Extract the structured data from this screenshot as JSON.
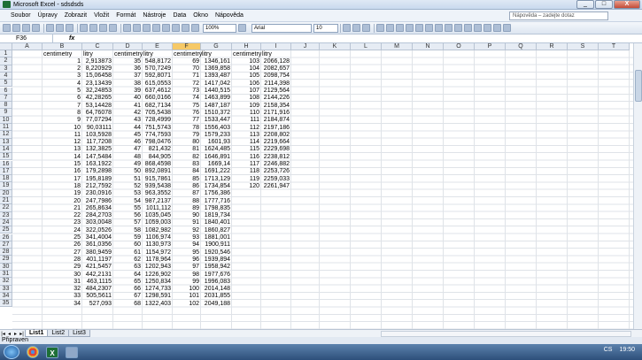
{
  "window": {
    "title": "Microsoft Excel - sdsdsds",
    "minimize": "_",
    "restore": "□",
    "close": "X"
  },
  "menu": [
    "Soubor",
    "Úpravy",
    "Zobrazit",
    "Vložit",
    "Formát",
    "Nástroje",
    "Data",
    "Okno",
    "Nápověda"
  ],
  "help_box": {
    "placeholder": "Nápověda – zadejte dotaz"
  },
  "toolbar": {
    "zoom": "100%",
    "font": "Arial",
    "font_size": "10"
  },
  "formula_bar": {
    "name_box": "F36",
    "fx": "fx",
    "value": ""
  },
  "columns": [
    "A",
    "B",
    "C",
    "D",
    "E",
    "F",
    "G",
    "H",
    "I",
    "J",
    "K",
    "L",
    "M",
    "N",
    "O",
    "P",
    "Q",
    "R",
    "S",
    "T"
  ],
  "selected_column": "F",
  "rows": [
    "1",
    "2",
    "3",
    "4",
    "5",
    "6",
    "7",
    "8",
    "9",
    "10",
    "11",
    "12",
    "13",
    "14",
    "15",
    "16",
    "17",
    "18",
    "19",
    "20",
    "21",
    "22",
    "23",
    "24",
    "25",
    "26",
    "27",
    "28",
    "29",
    "30",
    "31",
    "32",
    "33",
    "34",
    "35"
  ],
  "sheet": {
    "B": [
      "centimetry",
      "1",
      "2",
      "3",
      "4",
      "5",
      "6",
      "7",
      "8",
      "9",
      "10",
      "11",
      "12",
      "13",
      "14",
      "15",
      "16",
      "17",
      "18",
      "19",
      "20",
      "21",
      "22",
      "23",
      "24",
      "25",
      "26",
      "27",
      "28",
      "29",
      "30",
      "31",
      "32",
      "33",
      "34"
    ],
    "C": [
      "litry",
      "2,913873",
      "8,220929",
      "15,06458",
      "23,13439",
      "32,24853",
      "42,28265",
      "53,14428",
      "64,76078",
      "77,07294",
      "90,03111",
      "103,5928",
      "117,7208",
      "132,3825",
      "147,5484",
      "163,1922",
      "179,2898",
      "195,8189",
      "212,7592",
      "230,0916",
      "247,7986",
      "265,8634",
      "284,2703",
      "303,0048",
      "322,0526",
      "341,4004",
      "361,0356",
      "380,9459",
      "401,1197",
      "421,5457",
      "442,2131",
      "463,1115",
      "484,2307",
      "505,5611",
      "527,093"
    ],
    "D": [
      "centimetry",
      "35",
      "36",
      "37",
      "38",
      "39",
      "40",
      "41",
      "42",
      "43",
      "44",
      "45",
      "46",
      "47",
      "48",
      "49",
      "50",
      "51",
      "52",
      "53",
      "54",
      "55",
      "56",
      "57",
      "58",
      "59",
      "60",
      "61",
      "62",
      "63",
      "64",
      "65",
      "66",
      "67",
      "68"
    ],
    "E": [
      "litry",
      "548,8172",
      "570,7249",
      "592,8071",
      "615,0553",
      "637,4612",
      "660,0166",
      "682,7134",
      "705,5438",
      "728,4999",
      "751,5743",
      "774,7593",
      "798,0476",
      "821,432",
      "844,905",
      "868,4598",
      "892,0891",
      "915,7861",
      "939,5438",
      "963,3552",
      "987,2137",
      "1011,112",
      "1035,045",
      "1059,003",
      "1082,982",
      "1106,974",
      "1130,973",
      "1154,972",
      "1178,964",
      "1202,943",
      "1226,902",
      "1250,834",
      "1274,733",
      "1298,591",
      "1322,403"
    ],
    "F": [
      "centimetry",
      "69",
      "70",
      "71",
      "72",
      "73",
      "74",
      "75",
      "76",
      "77",
      "78",
      "79",
      "80",
      "81",
      "82",
      "83",
      "84",
      "85",
      "86",
      "87",
      "88",
      "89",
      "90",
      "91",
      "92",
      "93",
      "94",
      "95",
      "96",
      "97",
      "98",
      "99",
      "100",
      "101",
      "102"
    ],
    "G": [
      "litry",
      "1346,161",
      "1369,858",
      "1393,487",
      "1417,042",
      "1440,515",
      "1463,899",
      "1487,187",
      "1510,372",
      "1533,447",
      "1556,403",
      "1579,233",
      "1601,93",
      "1624,485",
      "1646,891",
      "1669,14",
      "1691,222",
      "1713,129",
      "1734,854",
      "1756,386",
      "1777,716",
      "1798,835",
      "1819,734",
      "1840,401",
      "1860,827",
      "1881,001",
      "1900,911",
      "1920,546",
      "1939,894",
      "1958,942",
      "1977,676",
      "1996,083",
      "2014,148",
      "2031,855",
      "2049,188"
    ],
    "H": [
      "centimetry",
      "103",
      "104",
      "105",
      "106",
      "107",
      "108",
      "109",
      "110",
      "111",
      "112",
      "113",
      "114",
      "115",
      "116",
      "117",
      "118",
      "119",
      "120"
    ],
    "I": [
      "litry",
      "2066,128",
      "2082,657",
      "2098,754",
      "2114,398",
      "2129,564",
      "2144,226",
      "2158,354",
      "2171,916",
      "2184,874",
      "2197,186",
      "2208,802",
      "2219,664",
      "2229,698",
      "2238,812",
      "2246,882",
      "2253,726",
      "2259,033",
      "2261,947"
    ]
  },
  "sheet_tabs": [
    "List1",
    "List2",
    "List3"
  ],
  "active_tab": "List1",
  "status": "Připraven",
  "taskbar": {
    "language": "CS",
    "time": "19:50"
  }
}
